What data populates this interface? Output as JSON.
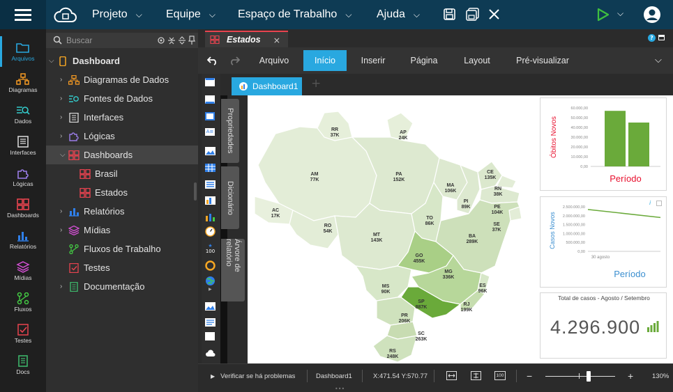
{
  "menu": {
    "items": [
      "Projeto",
      "Equipe",
      "Espaço de Trabalho",
      "Ajuda"
    ]
  },
  "rail": {
    "items": [
      "Arquivos",
      "Diagramas",
      "Dados",
      "Interfaces",
      "Lógicas",
      "Dashboards",
      "Relatórios",
      "Mídias",
      "Fluxos",
      "Testes",
      "Docs"
    ]
  },
  "tree": {
    "search_placeholder": "Buscar",
    "root": "Dashboard",
    "items": [
      {
        "label": "Diagramas de Dados"
      },
      {
        "label": "Fontes de Dados"
      },
      {
        "label": "Interfaces"
      },
      {
        "label": "Lógicas"
      },
      {
        "label": "Dashboards"
      },
      {
        "label": "Brasil"
      },
      {
        "label": "Estados"
      },
      {
        "label": "Relatórios"
      },
      {
        "label": "Mídias"
      },
      {
        "label": "Fluxos de Trabalho"
      },
      {
        "label": "Testes"
      },
      {
        "label": "Documentação"
      }
    ]
  },
  "doc_tab": {
    "label": "Estados",
    "close": "×"
  },
  "ribbon": {
    "tabs": [
      "Arquivo",
      "Início",
      "Inserir",
      "Página",
      "Layout",
      "Pré-visualizar"
    ],
    "active": "Início"
  },
  "dashboard_tab": {
    "label": "Dashboard1",
    "add": "+"
  },
  "side_tabs": {
    "properties": "Propriedades",
    "dictionary": "Dicionário",
    "tree": "Árvore de relatório"
  },
  "map": {
    "states": [
      {
        "code": "RR",
        "value": "37K"
      },
      {
        "code": "AP",
        "value": "24K"
      },
      {
        "code": "AM",
        "value": "77K"
      },
      {
        "code": "PA",
        "value": "152K"
      },
      {
        "code": "CE",
        "value": "135K"
      },
      {
        "code": "MA",
        "value": "106K"
      },
      {
        "code": "RN",
        "value": "38K"
      },
      {
        "code": "PI",
        "value": "89K"
      },
      {
        "code": "PE",
        "value": "104K"
      },
      {
        "code": "AC",
        "value": "17K"
      },
      {
        "code": "RO",
        "value": "54K"
      },
      {
        "code": "TO",
        "value": "86K"
      },
      {
        "code": "SE",
        "value": "37K"
      },
      {
        "code": "MT",
        "value": "143K"
      },
      {
        "code": "BA",
        "value": "289K"
      },
      {
        "code": "GO",
        "value": "455K"
      },
      {
        "code": "MG",
        "value": "336K"
      },
      {
        "code": "ES",
        "value": "96K"
      },
      {
        "code": "MS",
        "value": "90K"
      },
      {
        "code": "SP",
        "value": "887K"
      },
      {
        "code": "RJ",
        "value": "199K"
      },
      {
        "code": "PR",
        "value": "206K"
      },
      {
        "code": "SC",
        "value": "263K"
      },
      {
        "code": "RS",
        "value": "248K"
      }
    ]
  },
  "chart_data": [
    {
      "type": "bar",
      "ylabel": "Óbitos Novos",
      "xlabel": "Período",
      "ylim": [
        0,
        60000
      ],
      "yticks": [
        "60.000,00",
        "50.000,00",
        "40.000,00",
        "30.000,00",
        "20.000,00",
        "10.000,00",
        "0,00"
      ],
      "series": [
        {
          "values": [
            57000,
            45000
          ]
        }
      ],
      "color": "#6aaa3a"
    },
    {
      "type": "line",
      "ylabel": "Casos Novos",
      "xlabel": "Período",
      "ylim": [
        0,
        2500000
      ],
      "yticks": [
        "2.500.000,00",
        "2.000.000,00",
        "1.500.000,00",
        "1.000.000,00",
        "500.000,00",
        "0,00"
      ],
      "categories": [
        "30 agosto"
      ],
      "series": [
        {
          "values": [
            2350000,
            1900000
          ]
        }
      ],
      "color": "#6aaa3a"
    }
  ],
  "kpi": {
    "title": "Total de casos - Agosto / Setembro",
    "value": "4.296.900"
  },
  "status": {
    "check": "Verificar se há problemas",
    "page": "Dashboard1",
    "coords": "X:471.54 Y:570.77",
    "zoom": "130%"
  },
  "colors": {
    "topbar": "#0e3b54",
    "accent": "#29a8e0",
    "green": "#6aaa3a",
    "run": "#3fbf3f"
  }
}
